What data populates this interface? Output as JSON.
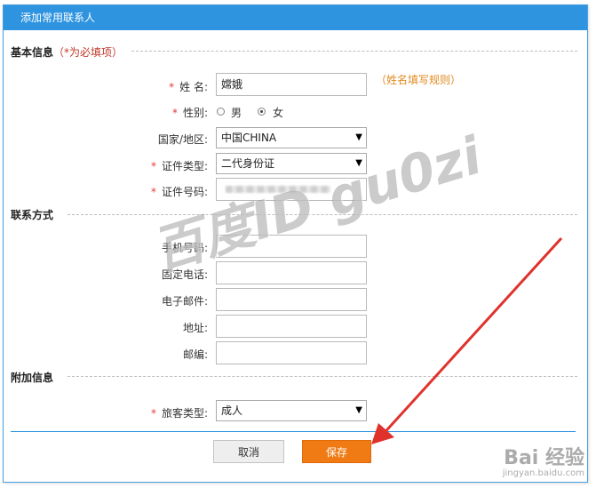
{
  "dialog": {
    "title": "添加常用联系人"
  },
  "sections": {
    "basic": {
      "title": "基本信息",
      "note": "（*为必填项）"
    },
    "contact": {
      "title": "联系方式"
    },
    "extra": {
      "title": "附加信息"
    }
  },
  "required_mark": "*",
  "fields": {
    "name": {
      "label": "姓 名:",
      "value": "嫦娥",
      "hint": "（姓名填写规则）"
    },
    "gender": {
      "label": "性别:",
      "options": [
        "男",
        "女"
      ],
      "selected": "女"
    },
    "country": {
      "label": "国家/地区:",
      "value": "中国CHINA"
    },
    "id_type": {
      "label": "证件类型:",
      "value": "二代身份证"
    },
    "id_number": {
      "label": "证件号码:"
    },
    "mobile": {
      "label": "手机号码:",
      "value": ""
    },
    "phone": {
      "label": "固定电话:",
      "value": ""
    },
    "email": {
      "label": "电子邮件:",
      "value": ""
    },
    "address": {
      "label": "地址:",
      "value": ""
    },
    "postcode": {
      "label": "邮编:",
      "value": ""
    },
    "passenger_type": {
      "label": "旅客类型:",
      "value": "成人"
    }
  },
  "buttons": {
    "cancel": "取消",
    "save": "保存"
  },
  "watermark": {
    "text": "百度ID gu0zi",
    "baidu": "Bai 经验",
    "baidu_url": "jingyan.baidu.com"
  },
  "colors": {
    "title_bar": "#2f94e0",
    "save_button": "#f07a14",
    "required": "#e23a3a",
    "hint": "#e08a1e",
    "arrow": "#e0322d"
  }
}
